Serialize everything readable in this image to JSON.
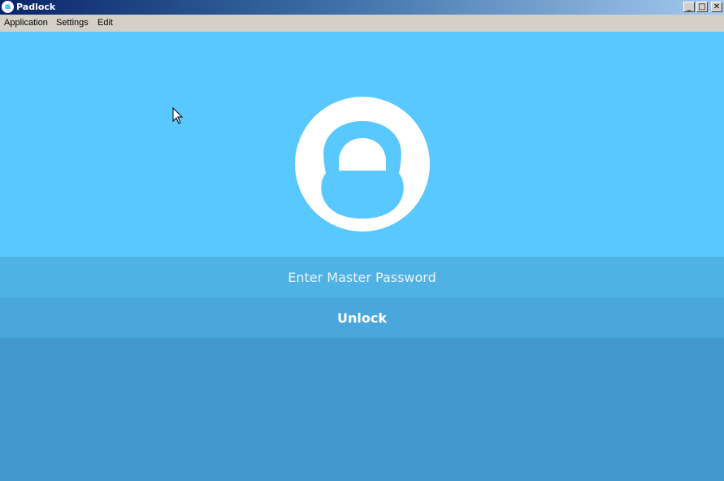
{
  "window": {
    "title": "Padlock",
    "controls": {
      "minimize": "_",
      "maximize": "□",
      "close": "✕"
    }
  },
  "menubar": {
    "items": [
      "Application",
      "Settings",
      "Edit"
    ]
  },
  "login": {
    "password_placeholder": "Enter Master Password",
    "unlock_label": "Unlock"
  },
  "icons": {
    "app": "padlock-icon",
    "logo": "padlock-logo-icon",
    "cursor": "mouse-pointer-icon"
  },
  "colors": {
    "titlebar_start": "#0a246a",
    "titlebar_end": "#a6caf0",
    "menubar": "#d4d0c8",
    "hero_bg": "#59c8ff",
    "password_bg": "#4fb1e4",
    "unlock_bg": "#4aa7dc",
    "bottom_bg": "#4499cc",
    "logo_fg": "#ffffff"
  }
}
